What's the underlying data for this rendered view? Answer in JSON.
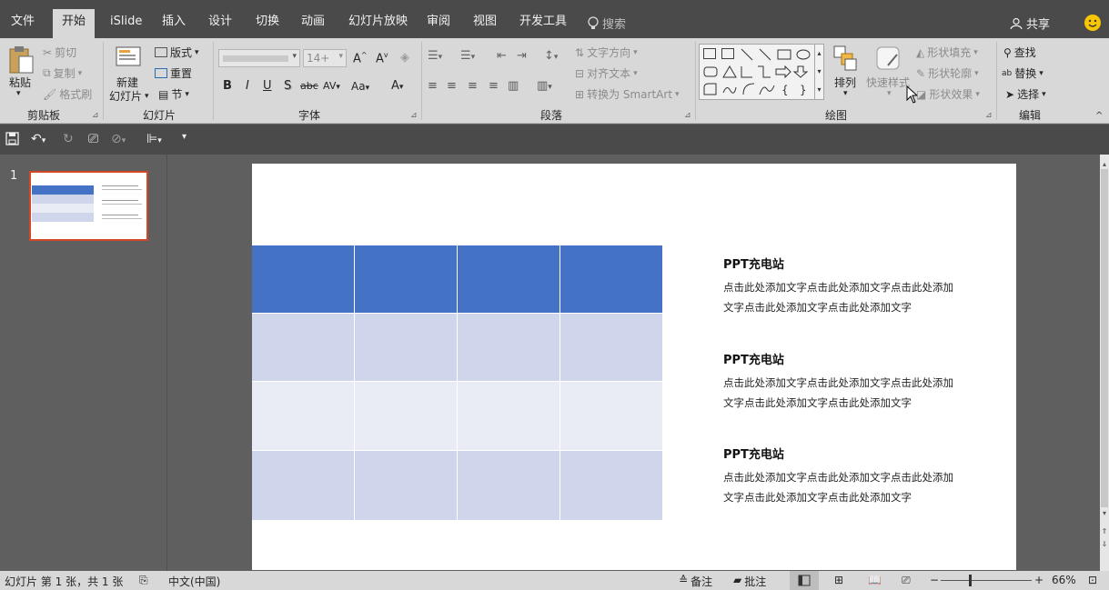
{
  "tabs": [
    {
      "label": "文件"
    },
    {
      "label": "开始"
    },
    {
      "label": "iSlide"
    },
    {
      "label": "插入"
    },
    {
      "label": "设计"
    },
    {
      "label": "切换"
    },
    {
      "label": "动画"
    },
    {
      "label": "幻灯片放映"
    },
    {
      "label": "审阅"
    },
    {
      "label": "视图"
    },
    {
      "label": "开发工具"
    }
  ],
  "search": {
    "placeholder": "搜索"
  },
  "share": {
    "label": "共享"
  },
  "ribbon": {
    "clipboard": {
      "paste": "粘贴",
      "cut": "剪切",
      "copy": "复制",
      "format_painter": "格式刷",
      "group": "剪贴板"
    },
    "slides": {
      "new_slide_line1": "新建",
      "new_slide_line2": "幻灯片",
      "layout": "版式",
      "reset": "重置",
      "section": "节",
      "group": "幻灯片"
    },
    "font": {
      "font_size": "14+",
      "group": "字体",
      "bold": "B",
      "italic": "I",
      "underline": "U",
      "shadow": "S",
      "strike": "abc",
      "spacing": "AV",
      "case": "Aa",
      "color": "A"
    },
    "paragraph": {
      "text_direction": "文字方向",
      "align_text": "对齐文本",
      "convert_smartart": "转换为 SmartArt",
      "group": "段落"
    },
    "drawing": {
      "arrange": "排列",
      "quick_styles": "快速样式",
      "shape_fill": "形状填充",
      "shape_outline": "形状轮廓",
      "shape_effects": "形状效果",
      "group": "绘图"
    },
    "editing": {
      "find": "查找",
      "replace": "替换",
      "select": "选择",
      "group": "编辑"
    }
  },
  "slide_panel": {
    "slide_number": "1"
  },
  "slide": {
    "items": [
      {
        "title": "PPT充电站",
        "line1": "点击此处添加文字点击此处添加文字点击此处添加",
        "line2": "文字点击此处添加文字点击此处添加文字"
      },
      {
        "title": "PPT充电站",
        "line1": "点击此处添加文字点击此处添加文字点击此处添加",
        "line2": "文字点击此处添加文字点击此处添加文字"
      },
      {
        "title": "PPT充电站",
        "line1": "点击此处添加文字点击此处添加文字点击此处添加",
        "line2": "文字点击此处添加文字点击此处添加文字"
      }
    ],
    "table_colors": {
      "header": "#4472c4",
      "row_dark": "#cfd5ea",
      "row_light": "#e9ebf5"
    }
  },
  "status": {
    "slide_info": "幻灯片 第 1 张，共 1 张",
    "language": "中文(中国)",
    "notes": "备注",
    "comments": "批注",
    "zoom": "66%"
  },
  "colors": {
    "accent": "#d24726",
    "tabbar": "#4a4a4a",
    "ribbon": "#d8d8d8"
  }
}
